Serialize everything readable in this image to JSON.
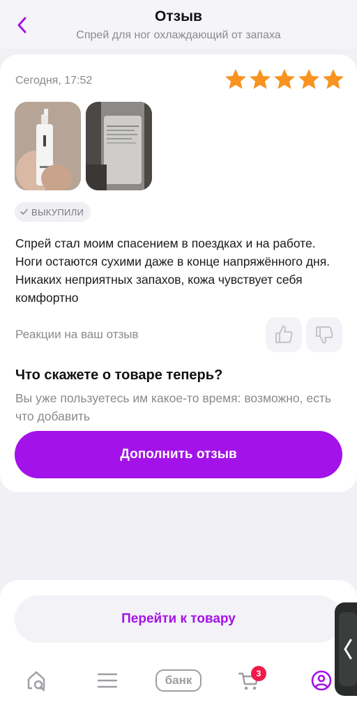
{
  "header": {
    "title": "Отзыв",
    "subtitle": "Спрей для ног охлаждающий от запаха"
  },
  "review": {
    "date": "Сегодня, 17:52",
    "rating": 5,
    "rating_max": 5,
    "star_color": "#f7931e",
    "badge": "ВЫКУПИЛИ",
    "text": "Спрей стал моим спасением в поездках и на работе. Ноги остаются сухими даже в конце напряжённого дня. Никаких неприятных запахов, кожа чувствует себя комфортно",
    "reactions_label": "Реакции на ваш отзыв"
  },
  "followup": {
    "question": "Что скажете о товаре теперь?",
    "hint": "Вы уже пользуетесь им какое-то время: возможно, есть что добавить",
    "button_label": "Дополнить отзыв"
  },
  "goto_product": {
    "label": "Перейти к товару"
  },
  "nav": {
    "bank_label": "банк",
    "cart_count": "3"
  },
  "colors": {
    "accent": "#a312e8",
    "badge_red": "#f01a4a"
  }
}
